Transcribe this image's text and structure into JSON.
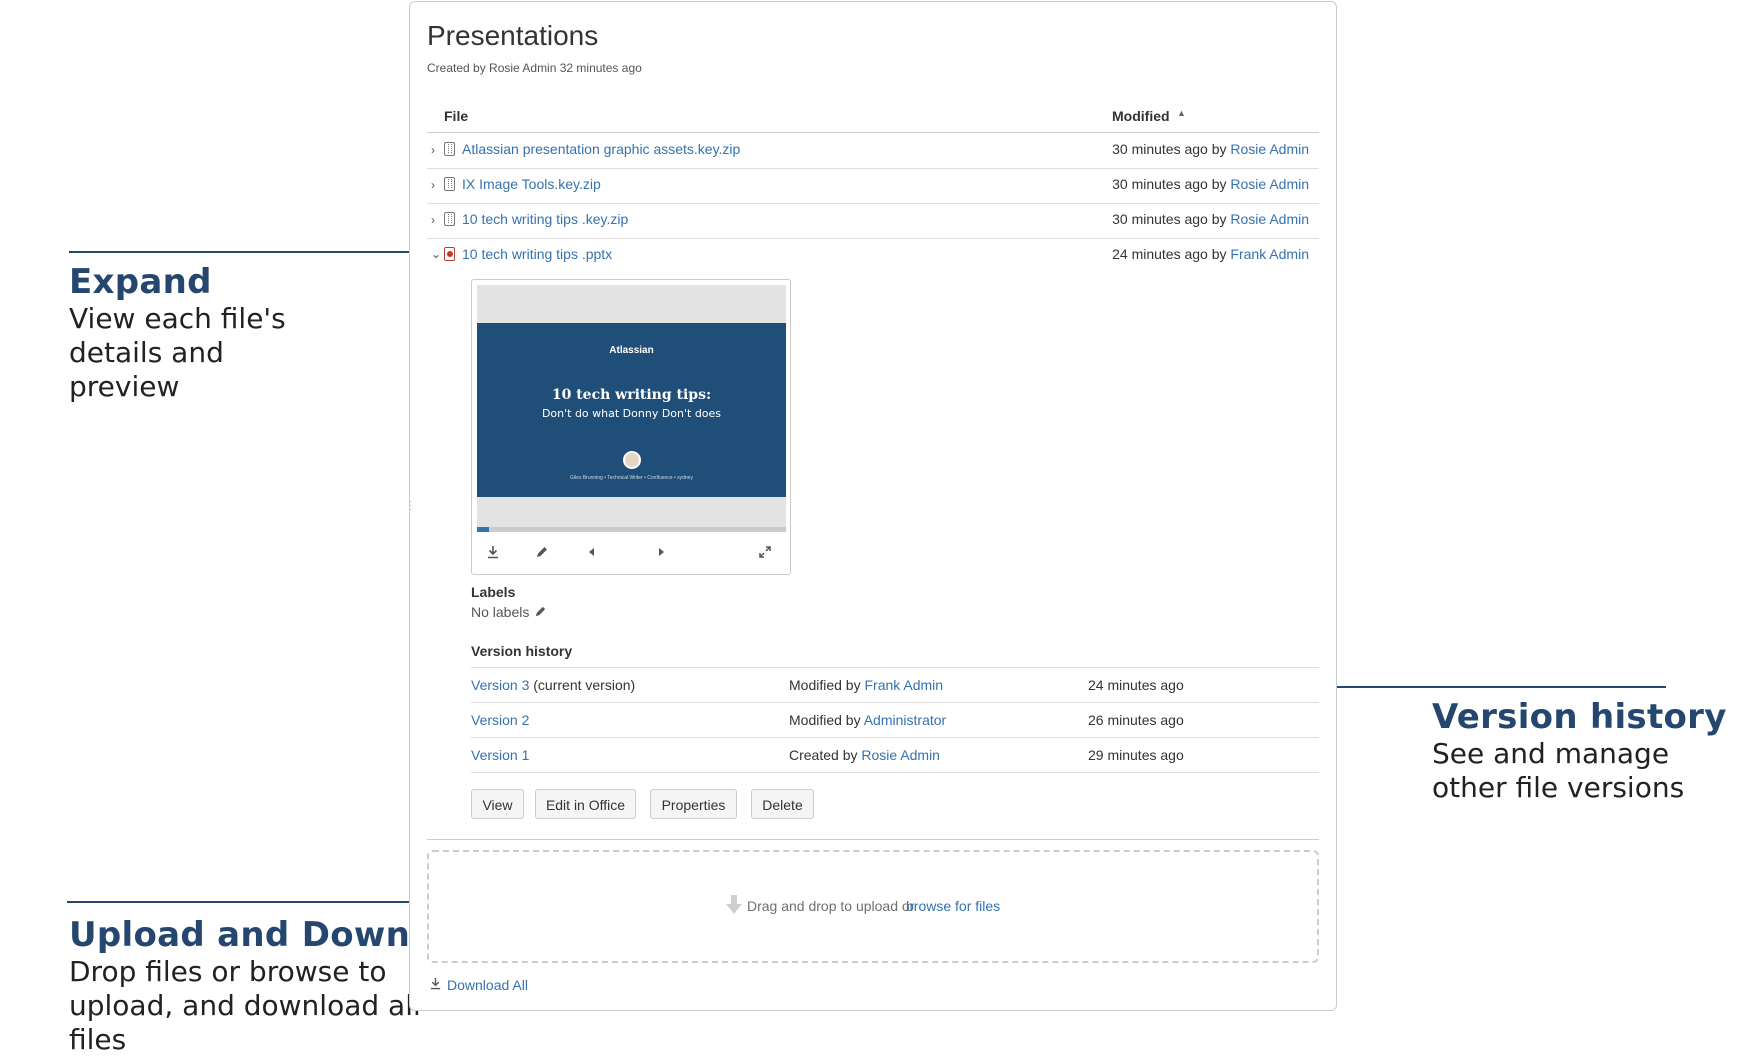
{
  "callouts": {
    "expand": {
      "title": "Expand",
      "body": [
        "View each file's",
        "details and",
        "preview"
      ]
    },
    "version_history": {
      "title": "Version history",
      "body": [
        "See and manage",
        "other file versions"
      ]
    },
    "upload_download": {
      "title": "Upload and Download",
      "body": [
        "Drop files or browse to",
        "upload, and download all",
        "files"
      ]
    }
  },
  "page": {
    "title": "Presentations",
    "subtitle": "Created by Rosie Admin 32 minutes ago"
  },
  "table": {
    "columns": {
      "file": "File",
      "modified": "Modified",
      "sort_indicator": "▲"
    },
    "files": [
      {
        "name": "Atlassian presentation graphic assets.key.zip",
        "icon": "zip-file-icon",
        "modified": "30 minutes ago by",
        "user": "Rosie Admin",
        "expanded": false
      },
      {
        "name": "IX Image Tools.key.zip",
        "icon": "zip-file-icon",
        "modified": "30 minutes ago by",
        "user": "Rosie Admin",
        "expanded": false
      },
      {
        "name": "10 tech writing tips .key.zip",
        "icon": "zip-file-icon",
        "modified": "30 minutes ago by",
        "user": "Rosie Admin",
        "expanded": false
      },
      {
        "name": "10 tech writing tips .pptx",
        "icon": "pptx-file-icon",
        "modified": "24 minutes ago by",
        "user": "Frank Admin",
        "expanded": true
      }
    ]
  },
  "preview": {
    "slide_logo": "Atlassian",
    "slide_title": "10 tech writing tips:",
    "slide_subtitle": "Don't do what Donny Don't does",
    "slide_footer": "Giles Brunning  •  Technical Writer  •  Confluence  •  sydney",
    "progress": 0.04,
    "controls": [
      "download-icon",
      "pencil-icon",
      "previous-icon",
      "next-icon",
      "fullscreen-icon"
    ]
  },
  "labels": {
    "heading": "Labels",
    "value": "No labels"
  },
  "version_history": {
    "heading": "Version history",
    "versions": [
      {
        "version": "Version 3",
        "note": " (current version)",
        "action": "Modified by",
        "user": "Frank Admin",
        "time": "24 minutes ago"
      },
      {
        "version": "Version 2",
        "note": "",
        "action": "Modified by",
        "user": "Administrator",
        "time": "26 minutes ago"
      },
      {
        "version": "Version 1",
        "note": "",
        "action": "Created by",
        "user": "Rosie Admin",
        "time": "29 minutes ago"
      }
    ]
  },
  "actions": {
    "view": "View",
    "edit_in_office": "Edit in Office",
    "properties": "Properties",
    "delete": "Delete"
  },
  "upload": {
    "text": "Drag and drop to upload or",
    "link": "browse for files"
  },
  "download_all": "Download All",
  "colors": {
    "link": "#3572b0",
    "callout_title": "#24466f",
    "slide_bg": "#1f4e79"
  }
}
